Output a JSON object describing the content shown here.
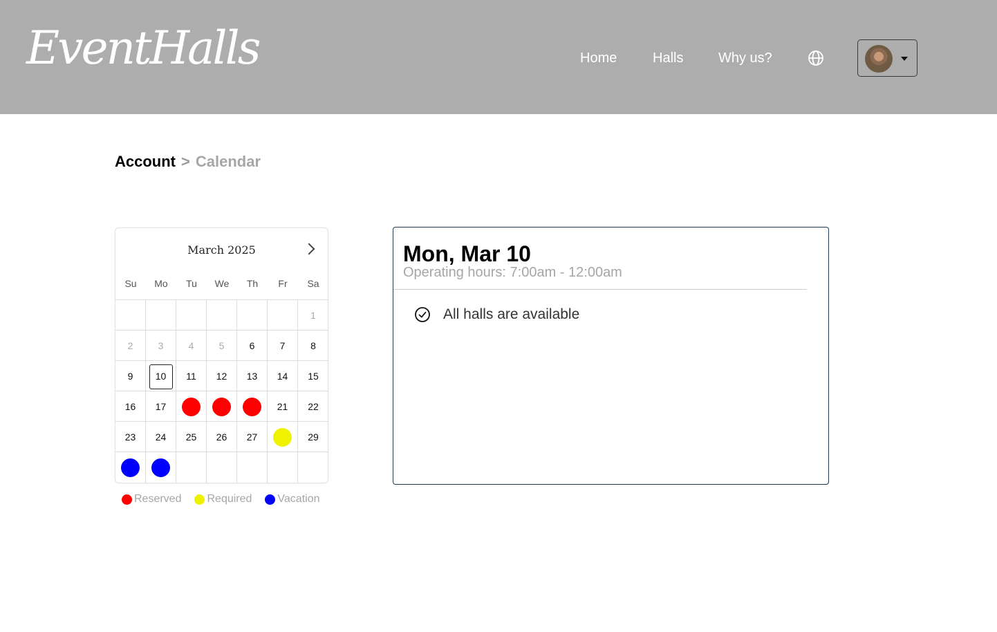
{
  "header": {
    "logo": "EventHalls",
    "nav": {
      "home": "Home",
      "halls": "Halls",
      "why_us": "Why us?"
    },
    "globe_icon": "globe-icon"
  },
  "breadcrumb": {
    "account": "Account",
    "separator": ">",
    "current": "Calendar"
  },
  "calendar": {
    "month_label": "March 2025",
    "weekdays": [
      "Su",
      "Mo",
      "Tu",
      "We",
      "Th",
      "Fr",
      "Sa"
    ],
    "selected_day": "10",
    "weeks": [
      [
        "",
        "",
        "",
        "",
        "",
        "",
        "1"
      ],
      [
        "2",
        "3",
        "4",
        "5",
        "6",
        "7",
        "8"
      ],
      [
        "9",
        "10",
        "11",
        "12",
        "13",
        "14",
        "15"
      ],
      [
        "16",
        "17",
        "",
        "",
        "",
        "21",
        "22"
      ],
      [
        "23",
        "24",
        "25",
        "26",
        "27",
        "",
        "29"
      ],
      [
        "",
        "",
        "",
        "",
        "",
        "",
        ""
      ]
    ],
    "muted_days": [
      "1",
      "2",
      "3",
      "4",
      "5"
    ],
    "markers": {
      "reserved": [
        "3-2",
        "3-3",
        "3-4"
      ],
      "required": [
        "4-5"
      ],
      "vacation": [
        "5-0",
        "5-1"
      ]
    },
    "colors": {
      "reserved": "#ff0000",
      "required": "#eef200",
      "vacation": "#0000ff"
    }
  },
  "legend": {
    "reserved": "Reserved",
    "required": "Required",
    "vacation": "Vacation"
  },
  "details": {
    "title": "Mon, Mar 10",
    "hours": "Operating hours: 7:00am - 12:00am",
    "status": "All halls are available"
  }
}
